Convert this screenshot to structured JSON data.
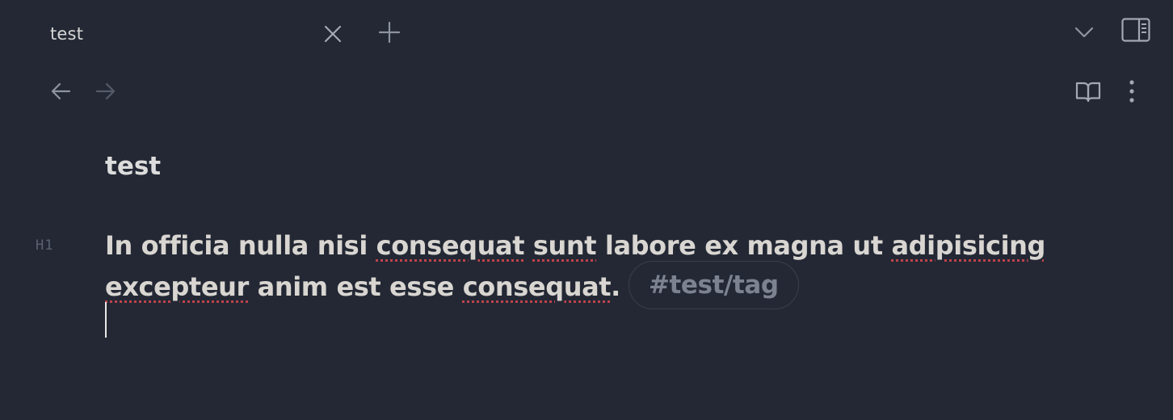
{
  "tabs": [
    {
      "title": "test",
      "active": true
    }
  ],
  "toolbar": {
    "back_icon": "arrow-left-icon",
    "forward_icon": "arrow-right-icon",
    "reading_icon": "book-open-icon",
    "more_icon": "more-vertical-icon"
  },
  "note": {
    "title": "test",
    "heading_level_marker": "H1",
    "heading_segments": [
      {
        "text": "In officia nulla nisi ",
        "misspelled": false
      },
      {
        "text": "consequat",
        "misspelled": true
      },
      {
        "text": " ",
        "misspelled": false
      },
      {
        "text": "sunt",
        "misspelled": true
      },
      {
        "text": " labore ex magna ut ",
        "misspelled": false
      },
      {
        "text": "adipisicing",
        "misspelled": true
      },
      {
        "text": " ",
        "misspelled": false
      },
      {
        "text": "excepteur",
        "misspelled": true
      },
      {
        "text": " anim est esse ",
        "misspelled": false
      },
      {
        "text": "consequat",
        "misspelled": true
      },
      {
        "text": ".",
        "misspelled": false
      }
    ],
    "tag": "#test/tag"
  },
  "colors": {
    "background": "#232834",
    "text": "#d9d6d2",
    "muted": "#7d8291",
    "spellcheck": "#c0424a"
  }
}
